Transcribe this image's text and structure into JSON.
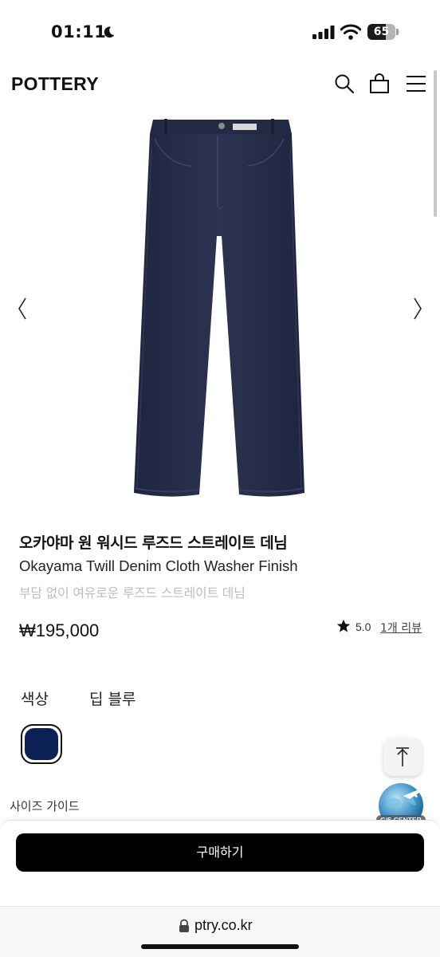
{
  "status_bar": {
    "time": "01:11",
    "battery": "65",
    "battery_level": 0.65
  },
  "header": {
    "logo": "POTTERY",
    "icons": [
      "search-icon",
      "shopping-bag-icon",
      "menu-icon"
    ]
  },
  "gallery": {
    "prev": "〈",
    "next": "〉"
  },
  "product": {
    "title_ko": "오카야마 원 워시드 루즈드 스트레이트 데님",
    "title_en": "Okayama Twill Denim Cloth Washer Finish",
    "tagline": "부담 없이 여유로운 루즈드 스트레이트 데님",
    "price": "₩195,000",
    "rating": "5.0",
    "reviews": "1개 리뷰"
  },
  "options": {
    "color_label": "색상",
    "color_value": "딥 블루",
    "swatch_color": "#0b2155"
  },
  "size_guide": "사이즈 가이드",
  "cs_badge": "C/S CENTER",
  "buy_button": "구매하기",
  "browser": {
    "url": "ptry.co.kr"
  }
}
